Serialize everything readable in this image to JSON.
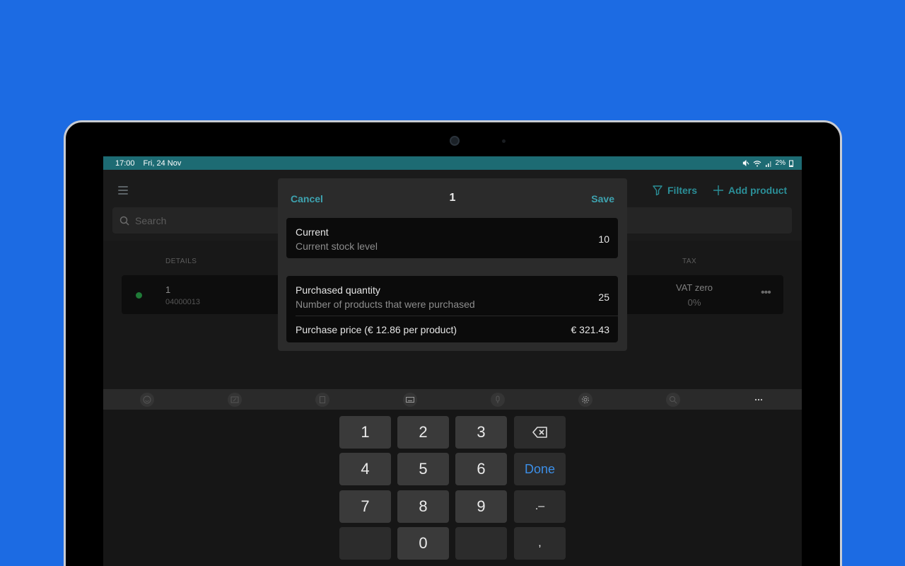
{
  "status": {
    "time": "17:00",
    "date": "Fri, 24 Nov",
    "battery": "2%"
  },
  "appbar": {
    "search_placeholder": "Search",
    "filters_label": "Filters",
    "add_product_label": "Add product"
  },
  "table": {
    "headers": {
      "details": "DETAILS",
      "tax": "TAX"
    },
    "row": {
      "name": "1",
      "code": "04000013",
      "tax_name": "VAT zero",
      "tax_rate": "0%",
      "more": "•••"
    }
  },
  "dialog": {
    "cancel": "Cancel",
    "title": "1",
    "save": "Save",
    "current_label": "Current",
    "current_sub": "Current stock level",
    "current_value": "10",
    "purchased_label": "Purchased quantity",
    "purchased_sub": "Number of products that were purchased",
    "purchased_value": "25",
    "price_label": "Purchase price (€ 12.86 per product)",
    "price_value": "€ 321.43"
  },
  "keyboard": {
    "toolbar_icons": [
      "emoji-icon",
      "handwriting-icon",
      "clipboard-icon",
      "keyboard-icon",
      "microphone-icon",
      "settings-icon",
      "search-icon",
      "more-icon"
    ],
    "keys": [
      "1",
      "2",
      "3",
      "4",
      "5",
      "6",
      "7",
      "8",
      "9",
      "0"
    ],
    "done_label": "Done",
    "dot_dash": ".–",
    "comma": ","
  }
}
